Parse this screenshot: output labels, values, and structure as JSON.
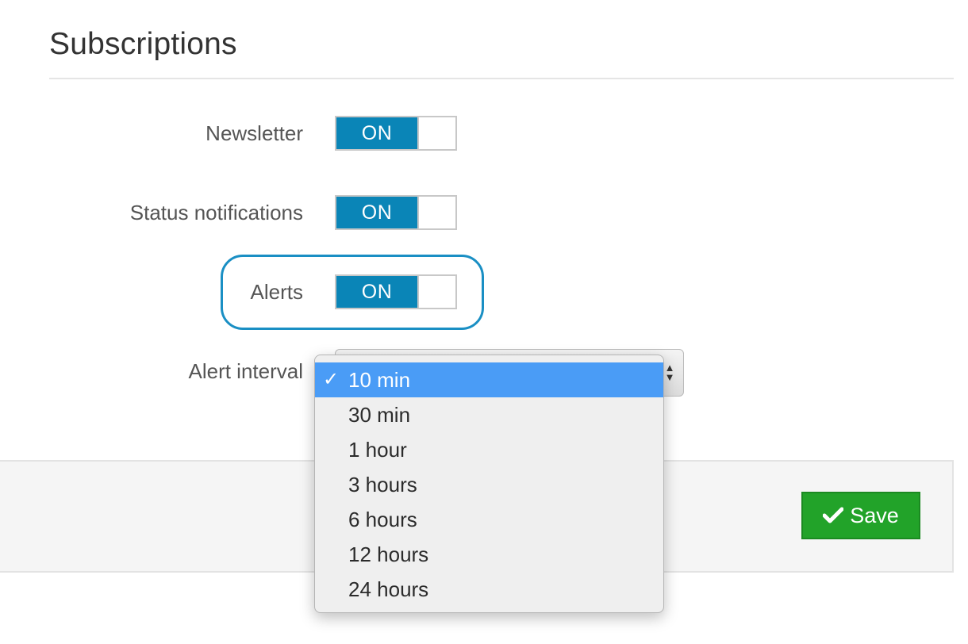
{
  "header": {
    "title": "Subscriptions"
  },
  "settings": {
    "newsletter": {
      "label": "Newsletter",
      "state": "ON"
    },
    "status_notifications": {
      "label": "Status notifications",
      "state": "ON"
    },
    "alerts": {
      "label": "Alerts",
      "state": "ON"
    },
    "alert_interval": {
      "label": "Alert interval",
      "selected": "10 min",
      "check_mark": "✓",
      "options": [
        "10 min",
        "30 min",
        "1 hour",
        "3 hours",
        "6 hours",
        "12 hours",
        "24 hours"
      ]
    }
  },
  "footer": {
    "save_label": "Save"
  },
  "colors": {
    "toggle_on": "#0a85b7",
    "focus_ring": "#1a8fc4",
    "selected_option": "#4a9cf6",
    "save_button": "#22a329"
  },
  "icons": {
    "save": "check-icon",
    "select": "up-down-arrows-icon"
  }
}
